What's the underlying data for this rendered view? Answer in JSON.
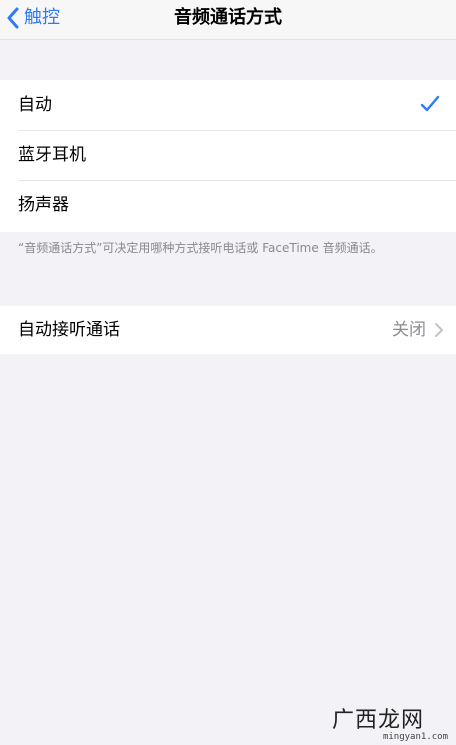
{
  "nav": {
    "back_label": "触控",
    "title": "音频通话方式"
  },
  "routing_options": [
    {
      "label": "自动",
      "selected": true
    },
    {
      "label": "蓝牙耳机",
      "selected": false
    },
    {
      "label": "扬声器",
      "selected": false
    }
  ],
  "footer_note": "“音频通话方式”可决定用哪种方式接听电话或 FaceTime 音频通话。",
  "auto_answer": {
    "label": "自动接听通话",
    "value": "关闭"
  },
  "watermark": {
    "brand": "广西龙网",
    "url": "mingyan1.com"
  },
  "colors": {
    "accent": "#2d7cf6",
    "background": "#f2f2f7",
    "secondary_text": "#8e8e93"
  },
  "icons": {
    "back": "chevron-left-icon",
    "selected": "checkmark-icon",
    "disclosure": "chevron-right-icon"
  }
}
